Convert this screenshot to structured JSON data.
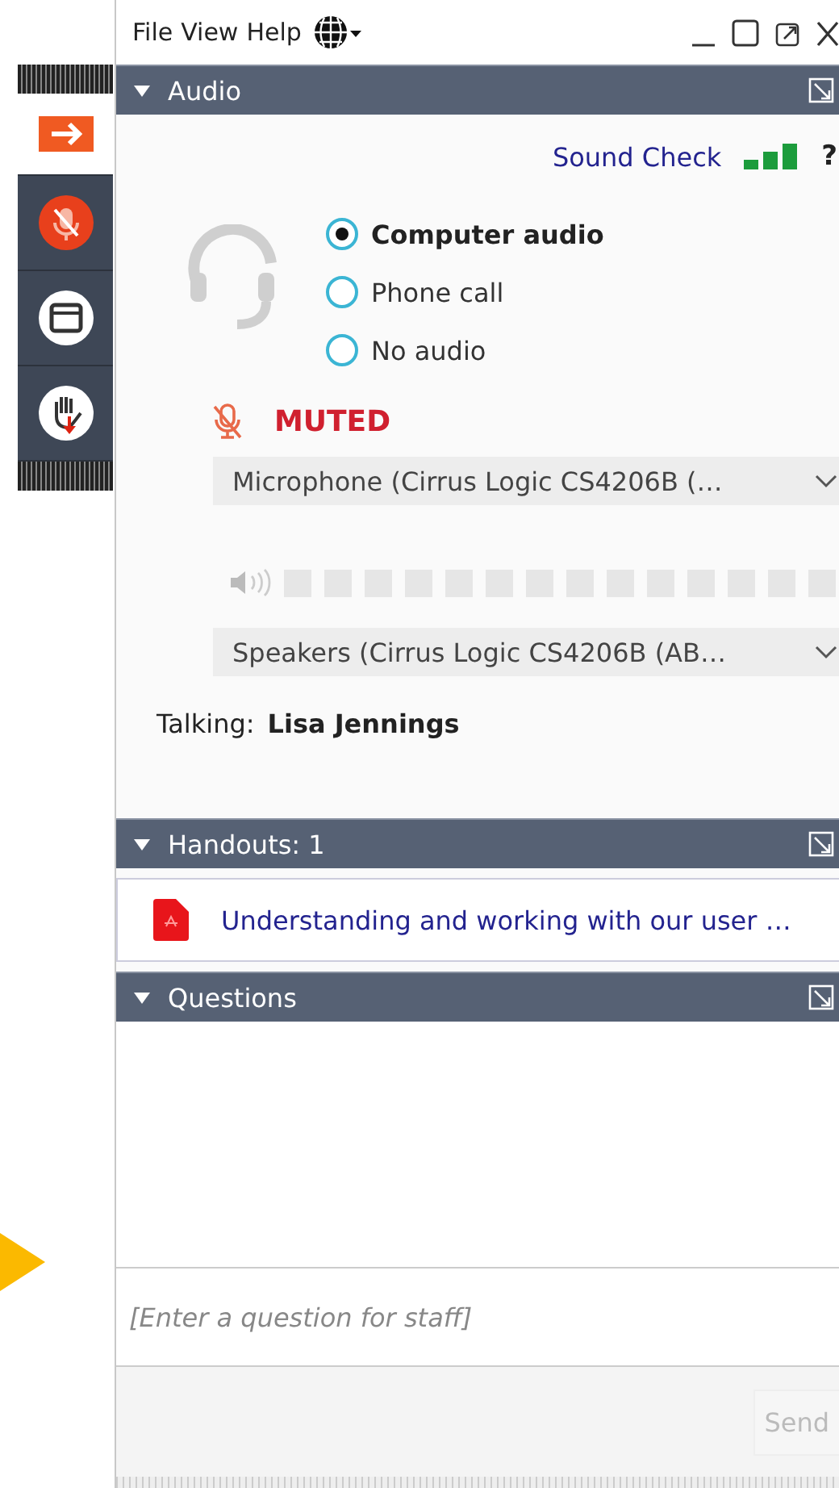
{
  "menu": [
    {
      "label": "File"
    },
    {
      "label": "View"
    },
    {
      "label": "Help"
    }
  ],
  "audio": {
    "title": "Audio",
    "expanded": true,
    "sound_check": "Sound Check",
    "help": "?",
    "muted": true,
    "status": "MUTED",
    "options": [
      {
        "label": "Computer audio",
        "selected": true
      },
      {
        "label": "Phone call",
        "selected": false
      },
      {
        "label": "No audio",
        "selected": false
      }
    ],
    "microphone": "Microphone (Cirrus Logic CS4206B (…",
    "speakers": "Speakers (Cirrus Logic CS4206B (AB…",
    "talking_label": "Talking:",
    "talking_name": "Lisa Jennings"
  },
  "handouts": {
    "title": "Handouts: 1",
    "expanded": true,
    "items": [
      {
        "title": "Understanding and working with our user …"
      }
    ]
  },
  "questions": {
    "title": "Questions",
    "expanded": true,
    "placeholder": "[Enter a question for staff]",
    "send": "Send"
  }
}
